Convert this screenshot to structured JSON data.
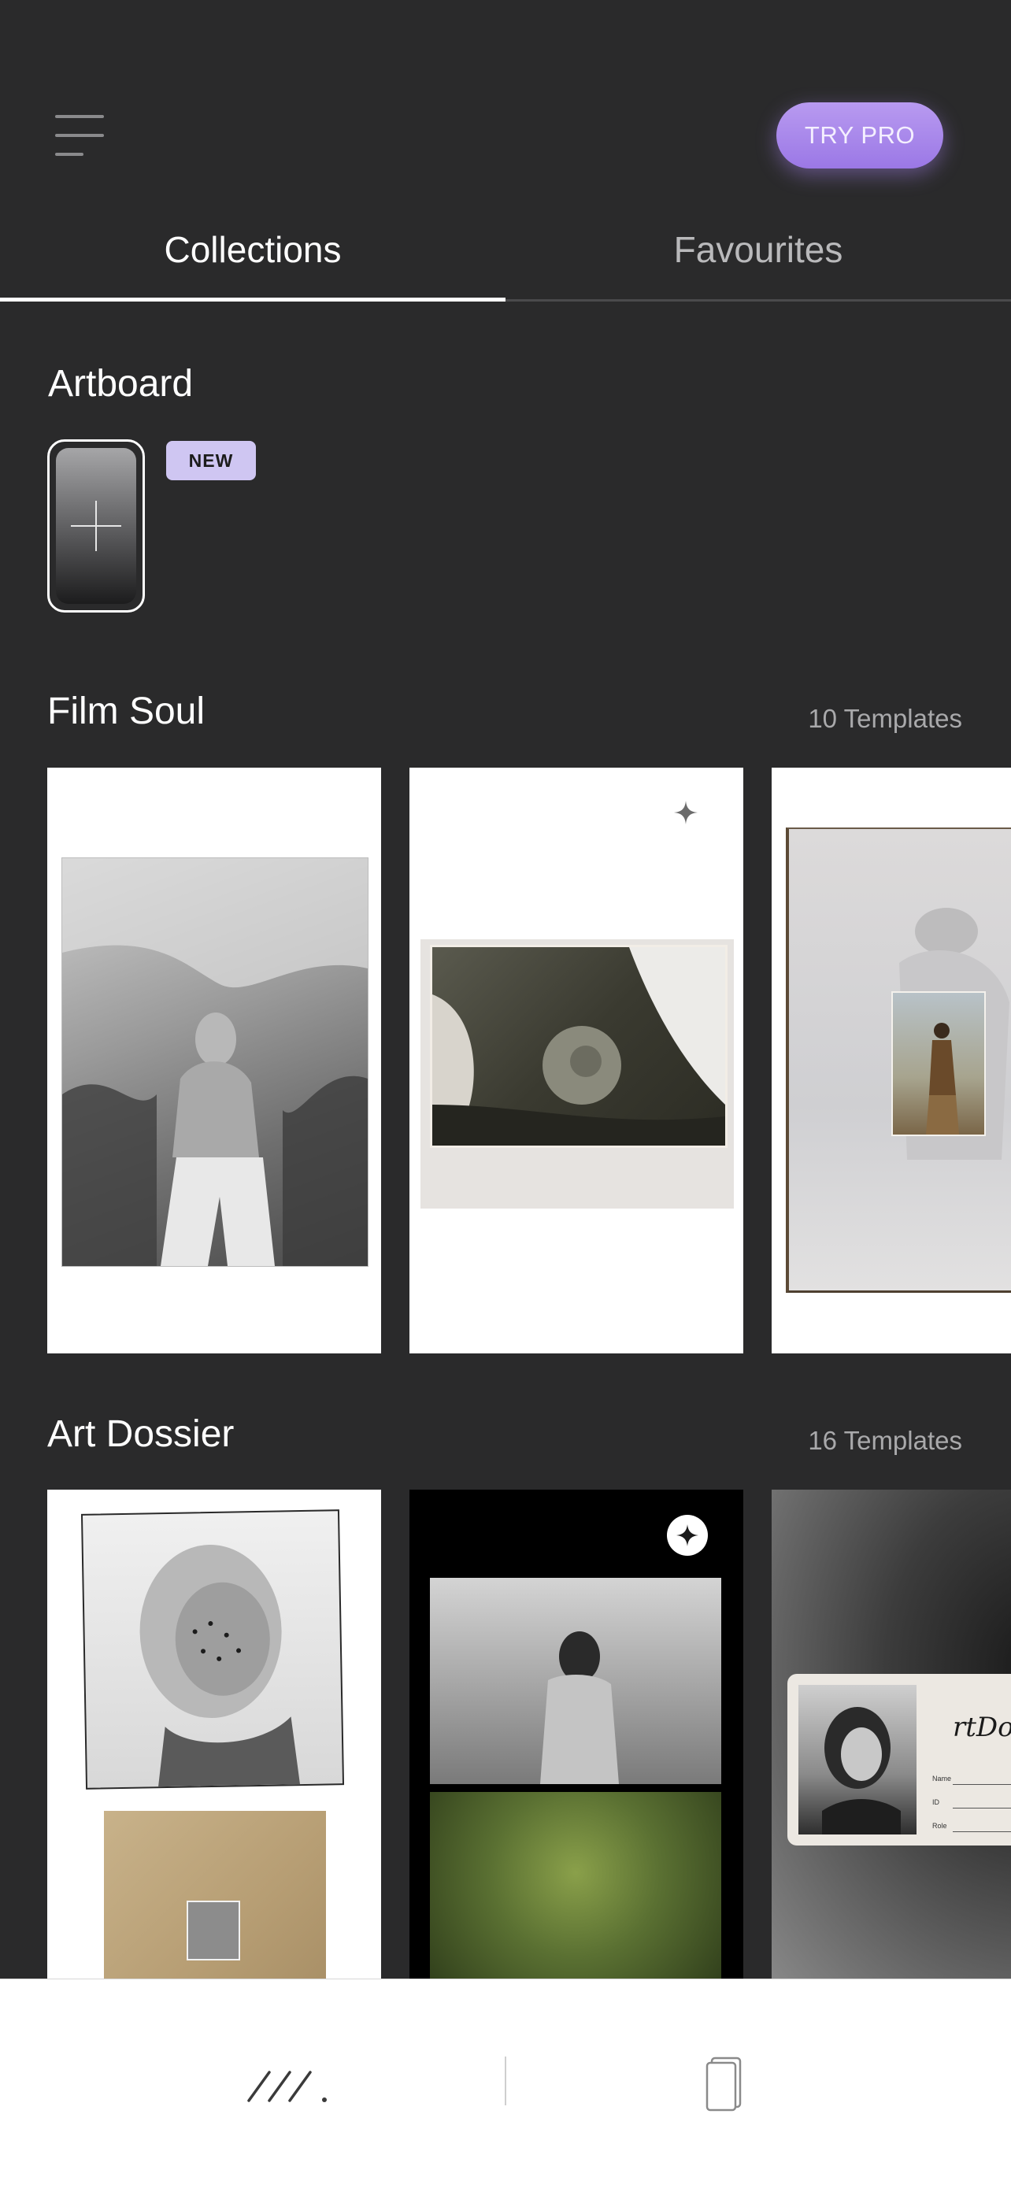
{
  "header": {
    "try_pro_label": "TRY PRO"
  },
  "tabs": {
    "collections": "Collections",
    "favourites": "Favourites"
  },
  "artboard": {
    "title": "Artboard",
    "badge": "NEW"
  },
  "film_soul": {
    "title": "Film Soul",
    "count": "10 Templates"
  },
  "art_dossier": {
    "title": "Art Dossier",
    "count": "16 Templates",
    "card3_text": "rtDo",
    "card3_fields": [
      "Name",
      "ID",
      "Role"
    ]
  },
  "colors": {
    "accent": "#a585ec",
    "background": "#2a2a2b",
    "badge": "#cfc6f2"
  },
  "icons": {
    "menu": "hamburger-icon",
    "sparkle": "sparkle-icon",
    "templates_tab": "slashes-icon",
    "device_tab": "phone-frame-icon"
  }
}
